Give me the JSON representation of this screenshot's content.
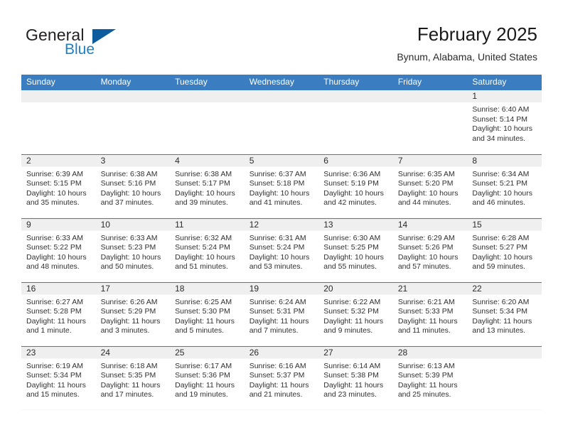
{
  "brand": {
    "name_part1": "General",
    "name_part2": "Blue",
    "accent_color": "#1f7fc4",
    "triangle_color": "#0d5c9e"
  },
  "header": {
    "title": "February 2025",
    "subtitle": "Bynum, Alabama, United States"
  },
  "calendar": {
    "header_bg": "#3a7dc0",
    "daynum_band_bg": "#efefef",
    "weekday_headers": [
      "Sunday",
      "Monday",
      "Tuesday",
      "Wednesday",
      "Thursday",
      "Friday",
      "Saturday"
    ],
    "weeks": [
      [
        {
          "day": "",
          "sunrise": "",
          "sunset": "",
          "daylight1": "",
          "daylight2": ""
        },
        {
          "day": "",
          "sunrise": "",
          "sunset": "",
          "daylight1": "",
          "daylight2": ""
        },
        {
          "day": "",
          "sunrise": "",
          "sunset": "",
          "daylight1": "",
          "daylight2": ""
        },
        {
          "day": "",
          "sunrise": "",
          "sunset": "",
          "daylight1": "",
          "daylight2": ""
        },
        {
          "day": "",
          "sunrise": "",
          "sunset": "",
          "daylight1": "",
          "daylight2": ""
        },
        {
          "day": "",
          "sunrise": "",
          "sunset": "",
          "daylight1": "",
          "daylight2": ""
        },
        {
          "day": "1",
          "sunrise": "Sunrise: 6:40 AM",
          "sunset": "Sunset: 5:14 PM",
          "daylight1": "Daylight: 10 hours",
          "daylight2": "and 34 minutes."
        }
      ],
      [
        {
          "day": "2",
          "sunrise": "Sunrise: 6:39 AM",
          "sunset": "Sunset: 5:15 PM",
          "daylight1": "Daylight: 10 hours",
          "daylight2": "and 35 minutes."
        },
        {
          "day": "3",
          "sunrise": "Sunrise: 6:38 AM",
          "sunset": "Sunset: 5:16 PM",
          "daylight1": "Daylight: 10 hours",
          "daylight2": "and 37 minutes."
        },
        {
          "day": "4",
          "sunrise": "Sunrise: 6:38 AM",
          "sunset": "Sunset: 5:17 PM",
          "daylight1": "Daylight: 10 hours",
          "daylight2": "and 39 minutes."
        },
        {
          "day": "5",
          "sunrise": "Sunrise: 6:37 AM",
          "sunset": "Sunset: 5:18 PM",
          "daylight1": "Daylight: 10 hours",
          "daylight2": "and 41 minutes."
        },
        {
          "day": "6",
          "sunrise": "Sunrise: 6:36 AM",
          "sunset": "Sunset: 5:19 PM",
          "daylight1": "Daylight: 10 hours",
          "daylight2": "and 42 minutes."
        },
        {
          "day": "7",
          "sunrise": "Sunrise: 6:35 AM",
          "sunset": "Sunset: 5:20 PM",
          "daylight1": "Daylight: 10 hours",
          "daylight2": "and 44 minutes."
        },
        {
          "day": "8",
          "sunrise": "Sunrise: 6:34 AM",
          "sunset": "Sunset: 5:21 PM",
          "daylight1": "Daylight: 10 hours",
          "daylight2": "and 46 minutes."
        }
      ],
      [
        {
          "day": "9",
          "sunrise": "Sunrise: 6:33 AM",
          "sunset": "Sunset: 5:22 PM",
          "daylight1": "Daylight: 10 hours",
          "daylight2": "and 48 minutes."
        },
        {
          "day": "10",
          "sunrise": "Sunrise: 6:33 AM",
          "sunset": "Sunset: 5:23 PM",
          "daylight1": "Daylight: 10 hours",
          "daylight2": "and 50 minutes."
        },
        {
          "day": "11",
          "sunrise": "Sunrise: 6:32 AM",
          "sunset": "Sunset: 5:24 PM",
          "daylight1": "Daylight: 10 hours",
          "daylight2": "and 51 minutes."
        },
        {
          "day": "12",
          "sunrise": "Sunrise: 6:31 AM",
          "sunset": "Sunset: 5:24 PM",
          "daylight1": "Daylight: 10 hours",
          "daylight2": "and 53 minutes."
        },
        {
          "day": "13",
          "sunrise": "Sunrise: 6:30 AM",
          "sunset": "Sunset: 5:25 PM",
          "daylight1": "Daylight: 10 hours",
          "daylight2": "and 55 minutes."
        },
        {
          "day": "14",
          "sunrise": "Sunrise: 6:29 AM",
          "sunset": "Sunset: 5:26 PM",
          "daylight1": "Daylight: 10 hours",
          "daylight2": "and 57 minutes."
        },
        {
          "day": "15",
          "sunrise": "Sunrise: 6:28 AM",
          "sunset": "Sunset: 5:27 PM",
          "daylight1": "Daylight: 10 hours",
          "daylight2": "and 59 minutes."
        }
      ],
      [
        {
          "day": "16",
          "sunrise": "Sunrise: 6:27 AM",
          "sunset": "Sunset: 5:28 PM",
          "daylight1": "Daylight: 11 hours",
          "daylight2": "and 1 minute."
        },
        {
          "day": "17",
          "sunrise": "Sunrise: 6:26 AM",
          "sunset": "Sunset: 5:29 PM",
          "daylight1": "Daylight: 11 hours",
          "daylight2": "and 3 minutes."
        },
        {
          "day": "18",
          "sunrise": "Sunrise: 6:25 AM",
          "sunset": "Sunset: 5:30 PM",
          "daylight1": "Daylight: 11 hours",
          "daylight2": "and 5 minutes."
        },
        {
          "day": "19",
          "sunrise": "Sunrise: 6:24 AM",
          "sunset": "Sunset: 5:31 PM",
          "daylight1": "Daylight: 11 hours",
          "daylight2": "and 7 minutes."
        },
        {
          "day": "20",
          "sunrise": "Sunrise: 6:22 AM",
          "sunset": "Sunset: 5:32 PM",
          "daylight1": "Daylight: 11 hours",
          "daylight2": "and 9 minutes."
        },
        {
          "day": "21",
          "sunrise": "Sunrise: 6:21 AM",
          "sunset": "Sunset: 5:33 PM",
          "daylight1": "Daylight: 11 hours",
          "daylight2": "and 11 minutes."
        },
        {
          "day": "22",
          "sunrise": "Sunrise: 6:20 AM",
          "sunset": "Sunset: 5:34 PM",
          "daylight1": "Daylight: 11 hours",
          "daylight2": "and 13 minutes."
        }
      ],
      [
        {
          "day": "23",
          "sunrise": "Sunrise: 6:19 AM",
          "sunset": "Sunset: 5:34 PM",
          "daylight1": "Daylight: 11 hours",
          "daylight2": "and 15 minutes."
        },
        {
          "day": "24",
          "sunrise": "Sunrise: 6:18 AM",
          "sunset": "Sunset: 5:35 PM",
          "daylight1": "Daylight: 11 hours",
          "daylight2": "and 17 minutes."
        },
        {
          "day": "25",
          "sunrise": "Sunrise: 6:17 AM",
          "sunset": "Sunset: 5:36 PM",
          "daylight1": "Daylight: 11 hours",
          "daylight2": "and 19 minutes."
        },
        {
          "day": "26",
          "sunrise": "Sunrise: 6:16 AM",
          "sunset": "Sunset: 5:37 PM",
          "daylight1": "Daylight: 11 hours",
          "daylight2": "and 21 minutes."
        },
        {
          "day": "27",
          "sunrise": "Sunrise: 6:14 AM",
          "sunset": "Sunset: 5:38 PM",
          "daylight1": "Daylight: 11 hours",
          "daylight2": "and 23 minutes."
        },
        {
          "day": "28",
          "sunrise": "Sunrise: 6:13 AM",
          "sunset": "Sunset: 5:39 PM",
          "daylight1": "Daylight: 11 hours",
          "daylight2": "and 25 minutes."
        },
        {
          "day": "",
          "sunrise": "",
          "sunset": "",
          "daylight1": "",
          "daylight2": ""
        }
      ]
    ]
  }
}
